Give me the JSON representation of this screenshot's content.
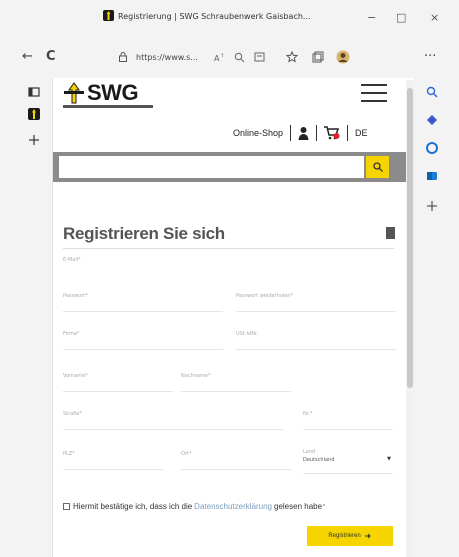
{
  "window": {
    "tab_title": "Registrierung | SWG Schraubenwerk Gaisbach...",
    "controls": {
      "minimize": "−",
      "maximize": "□",
      "close": "×"
    }
  },
  "toolbar": {
    "back": "←",
    "refresh": "C",
    "url": "https://www.s...",
    "more": "···"
  },
  "page": {
    "logo_text": "SWG",
    "nav": {
      "online_shop": "Online-Shop",
      "language": "DE"
    },
    "search": {
      "placeholder": "",
      "button_icon": "search-icon"
    },
    "form": {
      "title": "Registrieren Sie sich",
      "fields": {
        "email": "E-Mail*",
        "password": "Passwort*",
        "password_repeat": "Passwort wiederholen*",
        "company": "Firma*",
        "ust_id": "USt-IdNr.",
        "firstname": "Vorname*",
        "lastname": "Nachname*",
        "street": "Straße*",
        "number": "Nr.*",
        "zip": "PLZ*",
        "city": "Ort*",
        "country_label": "Land",
        "country_value": "Deutschland"
      },
      "consent_prefix": "Hiermit bestätige ich, dass ich die",
      "consent_link": "Datenschutzerklärung",
      "consent_suffix": "gelesen habe",
      "consent_required": "*",
      "submit_label": "Registrieren"
    }
  },
  "colors": {
    "accent": "#f5d400",
    "link": "#7a9cbf",
    "searchbar_bg": "#8b8b8b"
  }
}
